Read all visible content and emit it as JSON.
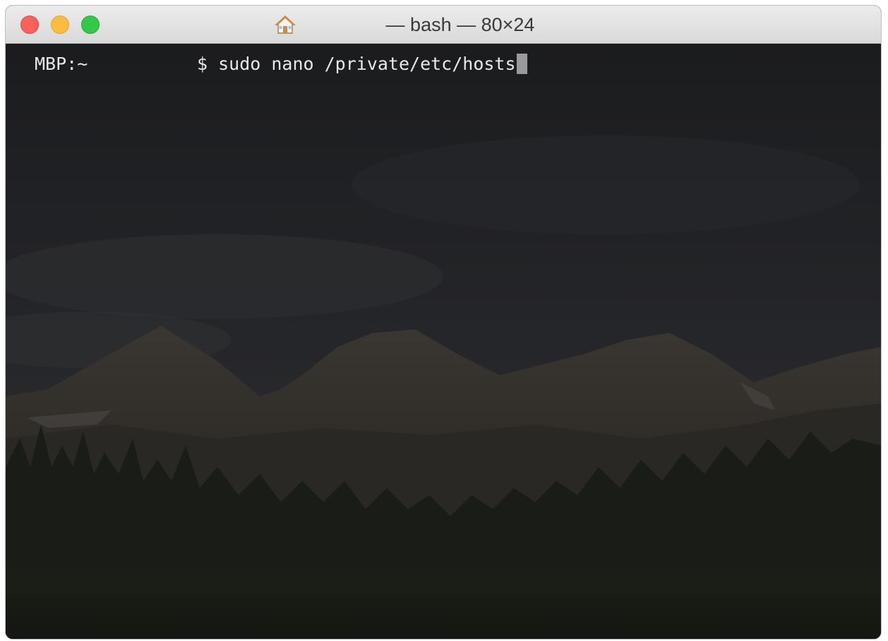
{
  "window": {
    "title": "— bash — 80×24",
    "title_icon": "home-icon",
    "buttons": [
      "close",
      "minimize",
      "zoom"
    ]
  },
  "terminal": {
    "hostname": "MBP:~",
    "prompt_command": "$ sudo nano /private/etc/hosts",
    "cursor": "block",
    "background": "dark mountain landscape wallpaper"
  },
  "colors": {
    "close": "#fc605b",
    "minimize": "#fdbc40",
    "zoom": "#34c84a",
    "terminal_text": "#e8e8e8"
  }
}
